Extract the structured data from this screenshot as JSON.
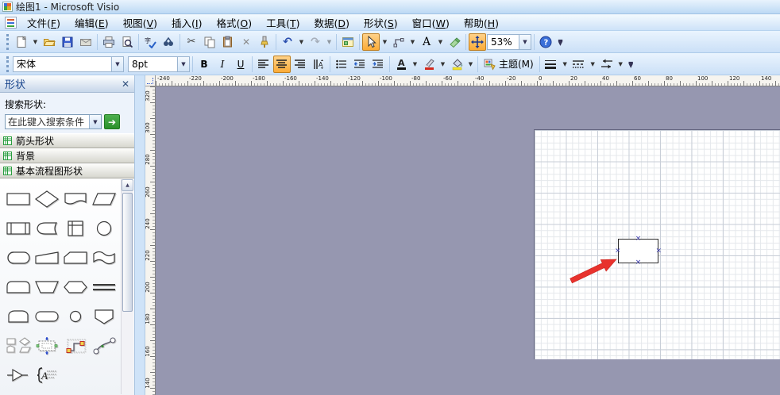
{
  "title_bar": {
    "title": "绘图1 - Microsoft Visio"
  },
  "menu_bar": {
    "items": [
      "文件(F)",
      "编辑(E)",
      "视图(V)",
      "插入(I)",
      "格式(O)",
      "工具(T)",
      "数据(D)",
      "形状(S)",
      "窗口(W)",
      "帮助(H)"
    ]
  },
  "toolbar_standard": {
    "zoom_value": "53%",
    "buttons": [
      "new-document",
      "open",
      "save",
      "mail",
      "print",
      "print-preview",
      "spelling",
      "research",
      "cut",
      "copy",
      "paste",
      "delete",
      "format-painter",
      "undo",
      "redo",
      "shapes-window",
      "pointer-tool",
      "connector-tool",
      "text-tool",
      "ink-tool",
      "pan-zoom",
      "zoom-combobox",
      "help"
    ],
    "selected": [
      "pointer-tool",
      "pan-zoom"
    ]
  },
  "toolbar_format": {
    "font_name": "宋体",
    "font_size": "8pt",
    "bold": "B",
    "italic": "I",
    "underline": "U",
    "theme_label": "主题(M)",
    "selected": [
      "align-center"
    ]
  },
  "shapes_panel": {
    "title": "形状",
    "search_label": "搜索形状:",
    "search_value": "在此键入搜索条件",
    "sections": [
      "箭头形状",
      "背景",
      "基本流程图形状"
    ],
    "shapes": [
      "rectangle",
      "diamond",
      "document",
      "parallelogram",
      "predefined-process",
      "display",
      "internal-storage",
      "circle",
      "direct-data",
      "manual-input",
      "card",
      "paper-tape",
      "delay",
      "manual-operation",
      "preparation",
      "parallel-lines",
      "stored-data",
      "terminator",
      "on-page-connector",
      "off-page-connector",
      "multi-shapes",
      "auto-size-box",
      "dynamic-connector",
      "curve-connector",
      "merge-triangle",
      "annotation"
    ]
  },
  "rulers": {
    "horizontal_labels": [
      -240,
      -220,
      -200,
      -180,
      -160,
      -140,
      -120,
      -100,
      -80,
      -60,
      -40,
      -20,
      0,
      20,
      40,
      60,
      80,
      100,
      120,
      140
    ],
    "vertical_labels": [
      320,
      300,
      280,
      260,
      240,
      220,
      200,
      180,
      160,
      140
    ]
  },
  "canvas": {
    "shape_on_page": "rectangle",
    "annotation": "red-arrow-pointer",
    "colors": {
      "canvas_bg": "#9697b0",
      "page_bg": "#ffffff",
      "arrow": "#e8322d",
      "selection_orange": "#fbab37"
    }
  }
}
